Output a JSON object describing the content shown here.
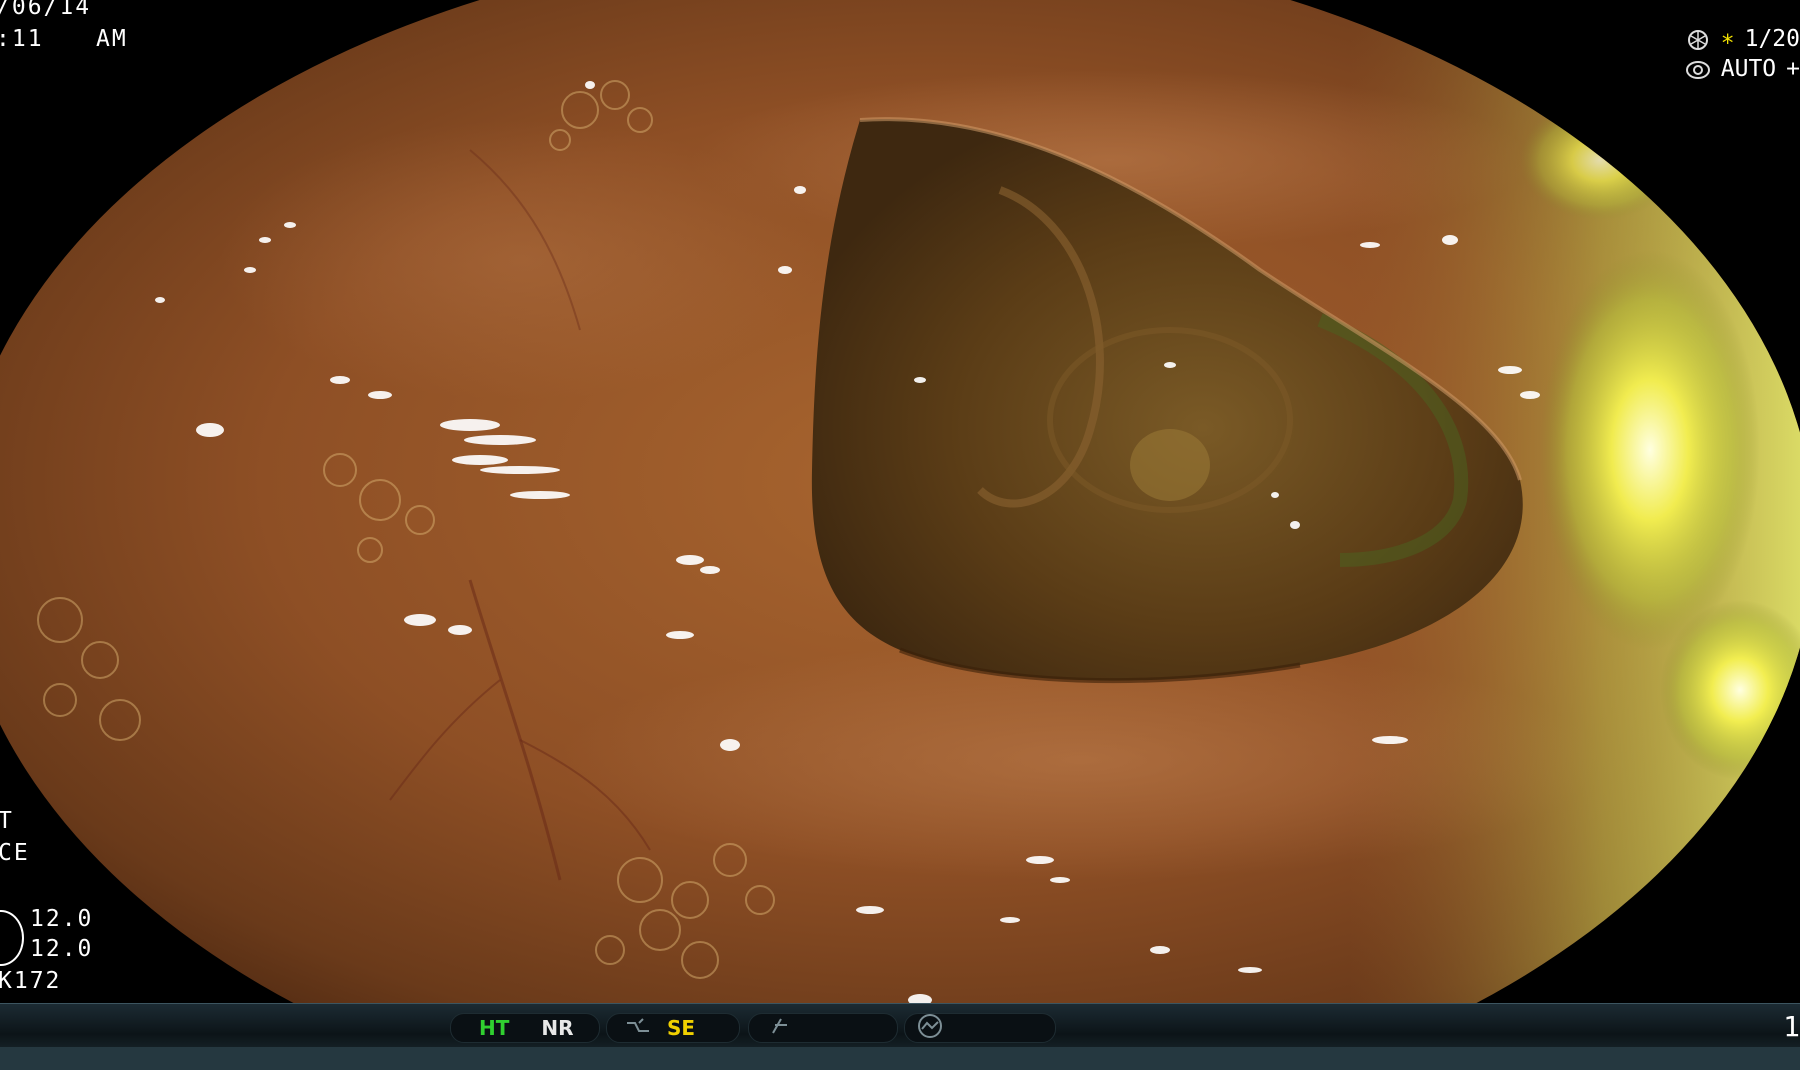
{
  "header": {
    "date": "/06/14",
    "time": ":11",
    "meridiem": "AM"
  },
  "top_right": {
    "shutter_star": "∗",
    "shutter_value": "1/20",
    "iris_mode": "AUTO",
    "iris_suffix": "+"
  },
  "left_panel": {
    "line1": "T",
    "line2": "CE",
    "value1": "12.0",
    "value2": "12.0",
    "scope_id": "K172"
  },
  "status_bar": {
    "ht_label": "HT",
    "nr_label": "NR",
    "se_label": "SE",
    "trailing_number": "1"
  },
  "icons": {
    "aperture_1": "aperture-icon",
    "aperture_2": "iris-icon",
    "ring": "ring-icon",
    "enhance": "enhance-wave-icon",
    "color": "color-slash-icon",
    "gauge": "gauge-icon"
  },
  "colors": {
    "tissue": "#9a5a2c",
    "lumen": "#5c3a14",
    "highlight": "#f0f040",
    "ht_green": "#30d030",
    "se_yellow": "#f0d000"
  }
}
